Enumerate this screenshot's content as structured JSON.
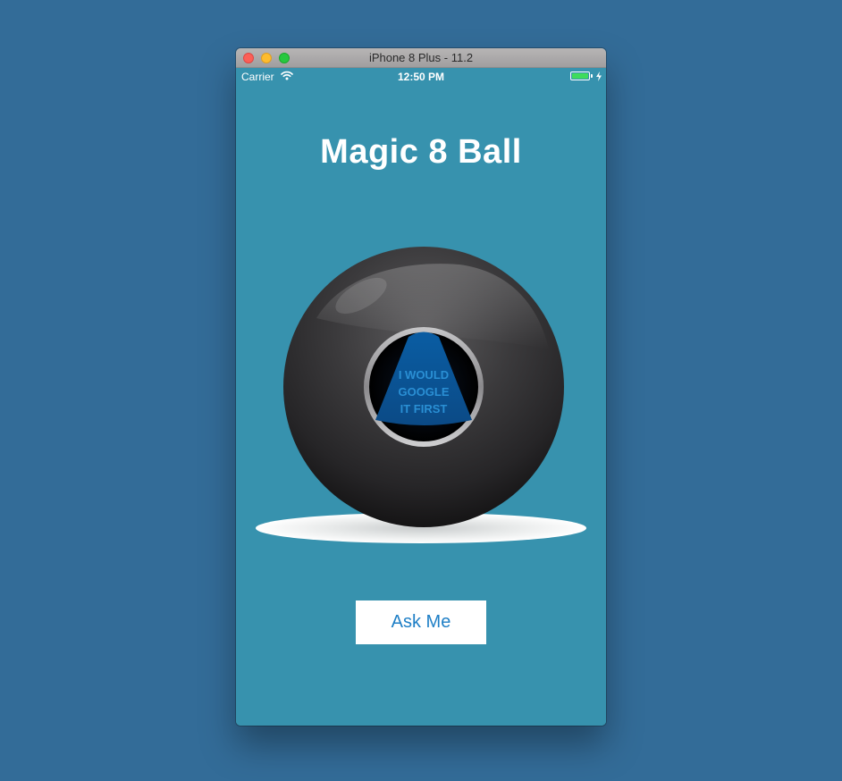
{
  "window": {
    "title": "iPhone 8 Plus - 11.2"
  },
  "status_bar": {
    "carrier": "Carrier",
    "time": "12:50 PM",
    "wifi_icon": "wifi-icon",
    "battery_icon": "battery-icon",
    "charging_icon": "charging-bolt-icon"
  },
  "app": {
    "title": "Magic 8 Ball",
    "answer_lines": [
      "I WOULD",
      "GOOGLE",
      "IT FIRST"
    ],
    "button_label": "Ask Me"
  },
  "colors": {
    "desktop_background": "#336c98",
    "screen_background": "#3792ae",
    "button_text": "#1f7fc6",
    "answer_text": "#2a8fd4"
  }
}
